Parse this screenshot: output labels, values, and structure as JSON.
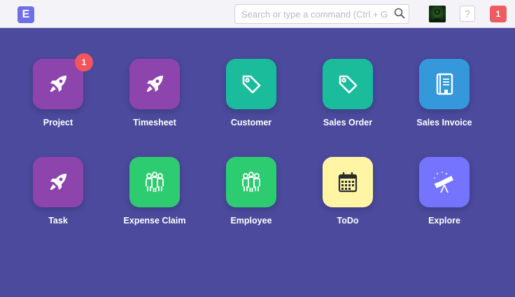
{
  "header": {
    "logo_letter": "E",
    "search": {
      "placeholder": "Search or type a command (Ctrl + G)",
      "value": ""
    },
    "help_label": "?",
    "notification_count": "1"
  },
  "colors": {
    "background": "#4b4a9c",
    "purple": "#8e44ad",
    "teal": "#1abc9c",
    "blue": "#3498db",
    "green": "#2ecc71",
    "yellow": "#fff5a5",
    "indigo": "#7574ff",
    "badge": "#f1565c"
  },
  "tiles": [
    {
      "label": "Project",
      "icon": "rocket-icon",
      "color": "#8e44ad",
      "badge": "1"
    },
    {
      "label": "Timesheet",
      "icon": "rocket-icon",
      "color": "#8e44ad"
    },
    {
      "label": "Customer",
      "icon": "tag-icon",
      "color": "#1abc9c"
    },
    {
      "label": "Sales Order",
      "icon": "tag-icon",
      "color": "#1abc9c"
    },
    {
      "label": "Sales Invoice",
      "icon": "book-icon",
      "color": "#3498db"
    },
    {
      "label": "Task",
      "icon": "rocket-icon",
      "color": "#8e44ad"
    },
    {
      "label": "Expense Claim",
      "icon": "group-icon",
      "color": "#2ecc71"
    },
    {
      "label": "Employee",
      "icon": "group-icon",
      "color": "#2ecc71"
    },
    {
      "label": "ToDo",
      "icon": "calendar-icon",
      "color": "#fff5a5"
    },
    {
      "label": "Explore",
      "icon": "telescope-icon",
      "color": "#7574ff"
    }
  ]
}
